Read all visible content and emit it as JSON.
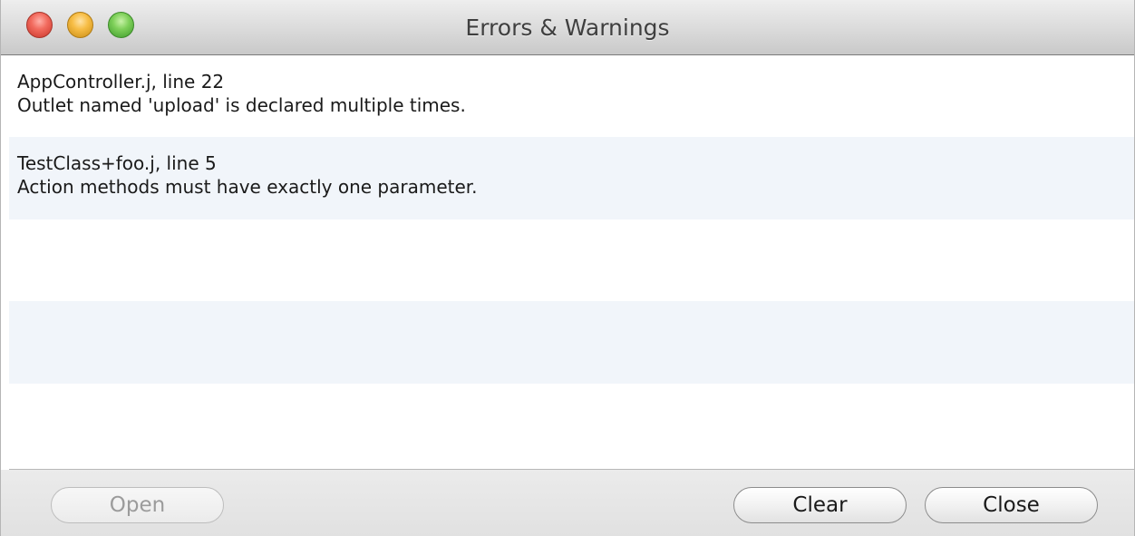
{
  "window": {
    "title": "Errors & Warnings"
  },
  "issues": [
    {
      "file": "AppController.j, line 22",
      "message": "Outlet named 'upload' is declared multiple times."
    },
    {
      "file": "TestClass+foo.j, line 5",
      "message": "Action methods must have exactly one parameter."
    }
  ],
  "buttons": {
    "open": "Open",
    "clear": "Clear",
    "close": "Close"
  },
  "colors": {
    "row_alternate": "#f1f5fa",
    "close_light": "#f26b5e",
    "minimize_light": "#f7bd45",
    "zoom_light": "#7fd05a"
  }
}
